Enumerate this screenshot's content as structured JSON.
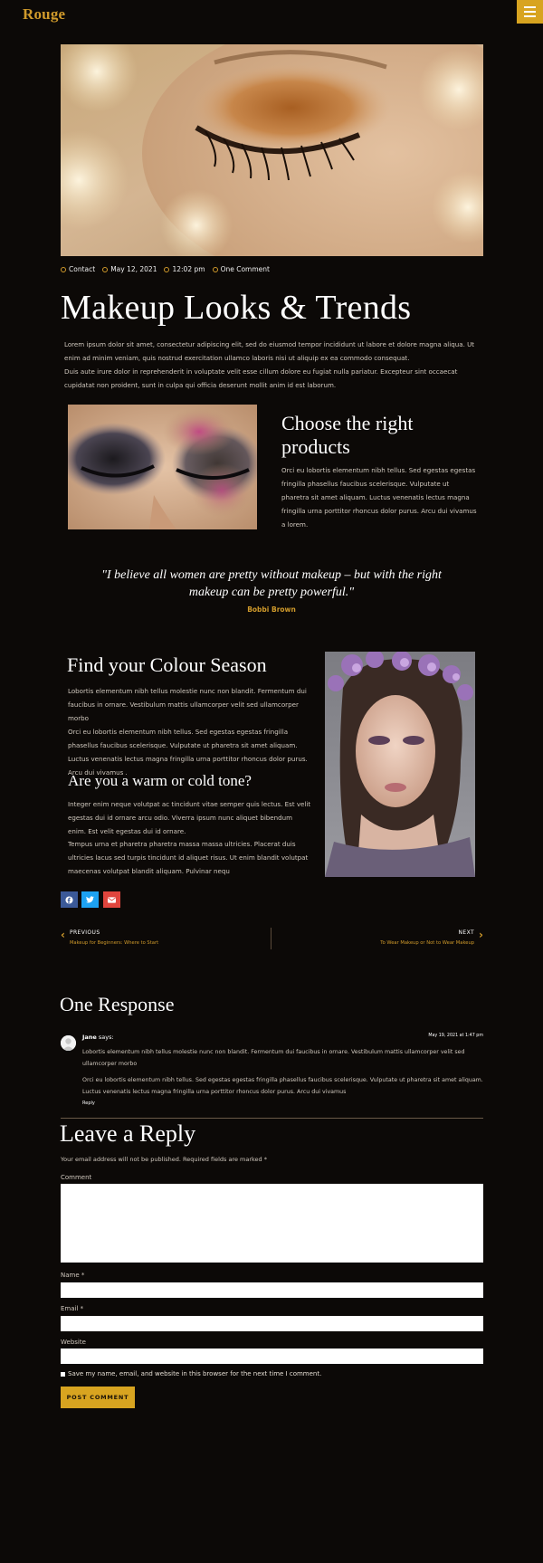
{
  "site": {
    "logo": "Rouge",
    "menu_icon": "hamburger-icon",
    "accent": "#d8a420"
  },
  "post_meta": {
    "category": "Contact",
    "date": "May 12, 2021",
    "time": "12:02 pm",
    "comments": "One Comment"
  },
  "article": {
    "title": "Makeup Looks & Trends",
    "intro_p1": "Lorem ipsum dolor sit amet, consectetur adipiscing elit, sed do eiusmod tempor incididunt ut labore et dolore magna aliqua. Ut enim ad minim veniam, quis nostrud exercitation ullamco laboris nisi ut aliquip ex ea commodo consequat.",
    "intro_p2": "Duis aute irure dolor in reprehenderit in voluptate velit esse cillum dolore eu fugiat nulla pariatur. Excepteur sint occaecat cupidatat non proident, sunt in culpa qui officia deserunt mollit anim id est laborum.",
    "choose_heading": "Choose the right products",
    "choose_text": "Orci eu lobortis elementum nibh tellus. Sed egestas egestas fringilla phasellus faucibus scelerisque. Vulputate ut pharetra sit amet aliquam. Luctus venenatis lectus magna fringilla urna porttitor rhoncus dolor purus. Arcu dui vivamus a lorem.",
    "quote": "\"I believe all women are pretty without makeup – but with the right makeup can be pretty powerful.\"",
    "quote_author": "Bobbi Brown",
    "colour_heading": "Find your Colour Season",
    "colour_p1": "Lobortis elementum nibh tellus molestie nunc non blandit. Fermentum dui faucibus in ornare. Vestibulum mattis ullamcorper velit sed ullamcorper morbo",
    "colour_p2": "Orci eu lobortis elementum nibh tellus. Sed egestas egestas fringilla phasellus faucibus scelerisque. Vulputate ut pharetra sit amet aliquam. Luctus venenatis lectus magna fringilla urna porttitor rhoncus dolor purus. Arcu dui vivamus .",
    "tone_heading": "Are you a warm or cold tone?",
    "tone_p1": "Integer enim neque volutpat ac tincidunt vitae semper quis lectus. Est velit egestas dui id ornare arcu odio. Viverra ipsum nunc aliquet bibendum enim. Est velit egestas dui id ornare.",
    "tone_p2": "Tempus urna et pharetra pharetra massa massa ultricies. Placerat duis ultricies lacus sed turpis tincidunt id aliquet risus. Ut enim blandit volutpat maecenas volutpat blandit aliquam. Pulvinar nequ"
  },
  "share": {
    "facebook_icon": "facebook-icon",
    "twitter_icon": "twitter-icon",
    "email_icon": "envelope-icon"
  },
  "post_nav": {
    "prev_label": "PREVIOUS",
    "prev_title": "Makeup for Beginners: Where to Start",
    "next_label": "NEXT",
    "next_title": "To Wear Makeup or Not to Wear Makeup"
  },
  "comments": {
    "heading": "One Response",
    "items": [
      {
        "author": "Jane",
        "says": "says:",
        "date": "May 19, 2021 at 1:47 pm",
        "p1": "Lobortis elementum nibh tellus molestie nunc non blandit. Fermentum dui faucibus in ornare. Vestibulum mattis ullamcorper velit sed ullamcorper morbo",
        "p2": "Orci eu lobortis elementum nibh tellus. Sed egestas egestas fringilla phasellus faucibus scelerisque. Vulputate ut pharetra sit amet aliquam. Luctus venenatis lectus magna fringilla urna porttitor rhoncus dolor purus. Arcu dui vivamus",
        "reply": "Reply"
      }
    ]
  },
  "reply_form": {
    "heading": "Leave a Reply",
    "note": "Your email address will not be published. Required fields are marked *",
    "comment_label": "Comment",
    "name_label": "Name *",
    "email_label": "Email *",
    "website_label": "Website",
    "save_label": "Save my name, email, and website in this browser for the next time I comment.",
    "submit_label": "POST COMMENT"
  }
}
